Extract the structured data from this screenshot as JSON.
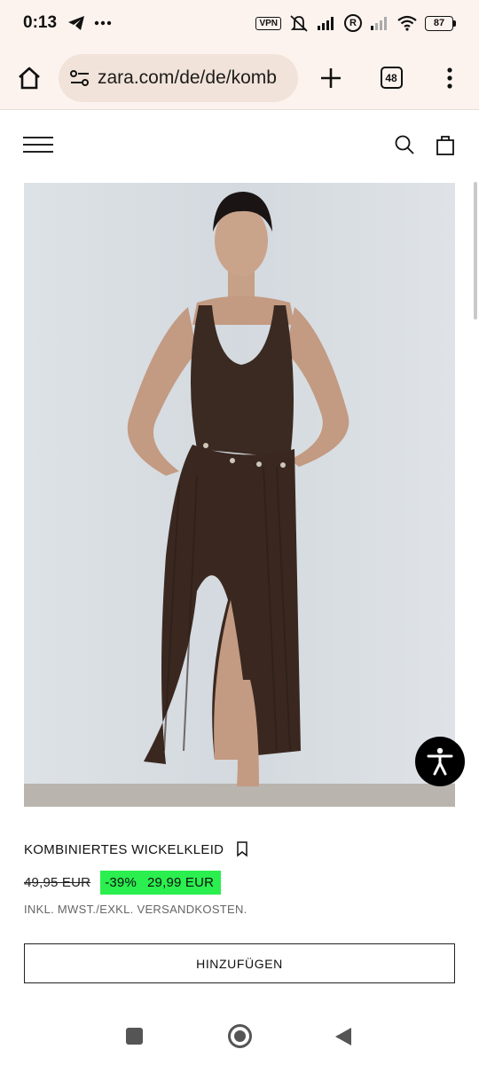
{
  "status_bar": {
    "time": "0:13",
    "vpn_label": "VPN",
    "r_label": "R",
    "battery": "87"
  },
  "browser": {
    "url": "zara.com/de/de/komb",
    "tab_count": "48"
  },
  "product": {
    "title": "KOMBINIERTES WICKELKLEID",
    "old_price": "49,95 EUR",
    "discount": "-39%",
    "new_price": "29,99 EUR",
    "tax_note": "INKL. MWST./EXKL. VERSANDKOSTEN.",
    "add_button": "HINZUFÜGEN"
  },
  "colors": {
    "sale_highlight": "#2aef4e",
    "browser_bar": "#fdf3ee",
    "url_pill": "#f1e3d9"
  },
  "icons": [
    "telegram-icon",
    "more-dots-icon",
    "mute-icon",
    "signal-icon",
    "wifi-icon",
    "home-icon",
    "site-settings-icon",
    "plus-icon",
    "menu-dots-icon",
    "hamburger-icon",
    "search-icon",
    "shopping-bag-icon",
    "bookmark-icon",
    "accessibility-icon"
  ]
}
